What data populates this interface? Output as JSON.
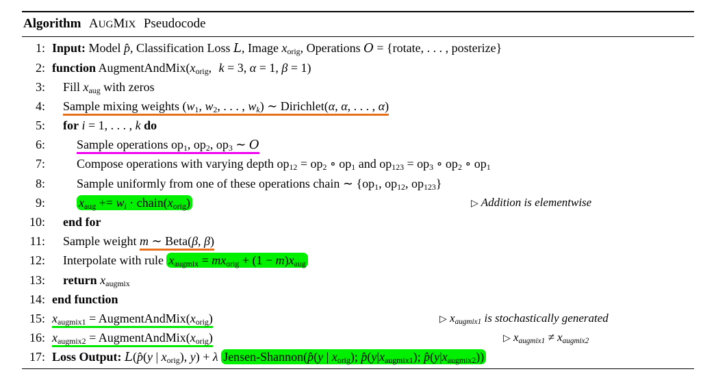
{
  "algorithm": {
    "label": "Algorithm",
    "name": "AugMix",
    "name_caps_first": "A",
    "name_caps_rest": "UG",
    "name_caps_m": "M",
    "name_caps_ix": "IX",
    "suffix": "Pseudocode",
    "title_full": "Algorithm AugMix Pseudocode"
  },
  "colors": {
    "highlight_green": "#00f000",
    "underline_orange": "#e8701a",
    "underline_magenta": "#ef00ef",
    "underline_green": "#00e800",
    "text": "#000000",
    "background": "#ffffff"
  },
  "lines": [
    {
      "number": "1",
      "indent": 0,
      "text": "Input: Model p̂, Classification Loss L, Image x_orig, Operations O = {rotate, . . . , posterize}",
      "keyword": "Input:",
      "annotation": "none"
    },
    {
      "number": "2",
      "indent": 0,
      "text": "function AugmentAndMix(x_orig, k = 3, α = 1, β = 1)",
      "keyword": "function",
      "annotation": "none"
    },
    {
      "number": "3",
      "indent": 1,
      "text": "Fill x_aug with zeros",
      "keyword": "",
      "annotation": "none"
    },
    {
      "number": "4",
      "indent": 1,
      "text": "Sample mixing weights (w_1, w_2, . . . , w_k) ~ Dirichlet(α, α, . . . , α)",
      "keyword": "",
      "annotation": "underline-orange"
    },
    {
      "number": "5",
      "indent": 1,
      "text": "for i = 1, . . . , k do",
      "keyword": "for / do",
      "annotation": "none"
    },
    {
      "number": "6",
      "indent": 2,
      "text": "Sample operations op_1, op_2, op_3 ~ O",
      "keyword": "",
      "annotation": "underline-magenta"
    },
    {
      "number": "7",
      "indent": 2,
      "text": "Compose operations with varying depth op_12 = op_2 ∘ op_1 and op_123 = op_3 ∘ op_2 ∘ op_1",
      "keyword": "",
      "annotation": "none"
    },
    {
      "number": "8",
      "indent": 2,
      "text": "Sample uniformly from one of these operations chain ~ {op_1, op_12, op_123}",
      "keyword": "",
      "annotation": "none"
    },
    {
      "number": "9",
      "indent": 2,
      "text": "x_aug += w_i · chain(x_orig)",
      "keyword": "",
      "annotation": "highlight-green",
      "comment": "Addition is elementwise"
    },
    {
      "number": "10",
      "indent": 1,
      "text": "end for",
      "keyword": "end for",
      "annotation": "none"
    },
    {
      "number": "11",
      "indent": 1,
      "text": "Sample weight m ~ Beta(β, β)",
      "keyword": "",
      "annotation": "underline-orange-partial"
    },
    {
      "number": "12",
      "indent": 1,
      "text": "Interpolate with rule x_augmix = m x_orig + (1 − m) x_aug",
      "keyword": "",
      "annotation": "highlight-green-partial"
    },
    {
      "number": "13",
      "indent": 1,
      "text": "return x_augmix",
      "keyword": "return",
      "annotation": "none"
    },
    {
      "number": "14",
      "indent": 0,
      "text": "end function",
      "keyword": "end function",
      "annotation": "none"
    },
    {
      "number": "15",
      "indent": 0,
      "text": "x_augmix1 = AugmentAndMix(x_orig)",
      "keyword": "",
      "annotation": "underline-green",
      "comment": "x_augmix1 is stochastically generated"
    },
    {
      "number": "16",
      "indent": 0,
      "text": "x_augmix2 = AugmentAndMix(x_orig)",
      "keyword": "",
      "annotation": "underline-green",
      "comment": "x_augmix1 ≠ x_augmix2"
    },
    {
      "number": "17",
      "indent": 0,
      "text": "Loss Output: L(p̂(y | x_orig), y) + λ Jensen-Shannon(p̂(y | x_orig); p̂(y|x_augmix1); p̂(y|x_augmix2))",
      "keyword": "Loss Output:",
      "annotation": "highlight-green-partial"
    }
  ],
  "tokens": {
    "input_kw": "Input:",
    "model": "Model",
    "classification_loss": "Classification Loss",
    "image": "Image",
    "operations": "Operations",
    "rotate": "rotate",
    "posterize": "posterize",
    "dots": ". . . ,",
    "function_kw": "function",
    "augmentandmix": "AugmentAndMix",
    "fill": "Fill",
    "with_zeros": "with zeros",
    "sample_mixing_weights": "Sample mixing weights",
    "dirichlet": "Dirichlet",
    "for_kw": "for",
    "do_kw": "do",
    "sample_operations": "Sample operations",
    "compose_operations": "Compose operations with varying depth",
    "and": "and",
    "sample_uniformly": "Sample uniformly from one of these operations chain",
    "chain": "chain",
    "end_for": "end for",
    "sample_weight": "Sample weight",
    "beta": "Beta",
    "interpolate": "Interpolate with rule",
    "return_kw": "return",
    "end_function": "end function",
    "loss_output_kw": "Loss Output:",
    "jensen_shannon": "Jensen-Shannon",
    "comment9": "Addition is elementwise",
    "comment15a": "is stochastically generated",
    "plus_eq": "+="
  }
}
